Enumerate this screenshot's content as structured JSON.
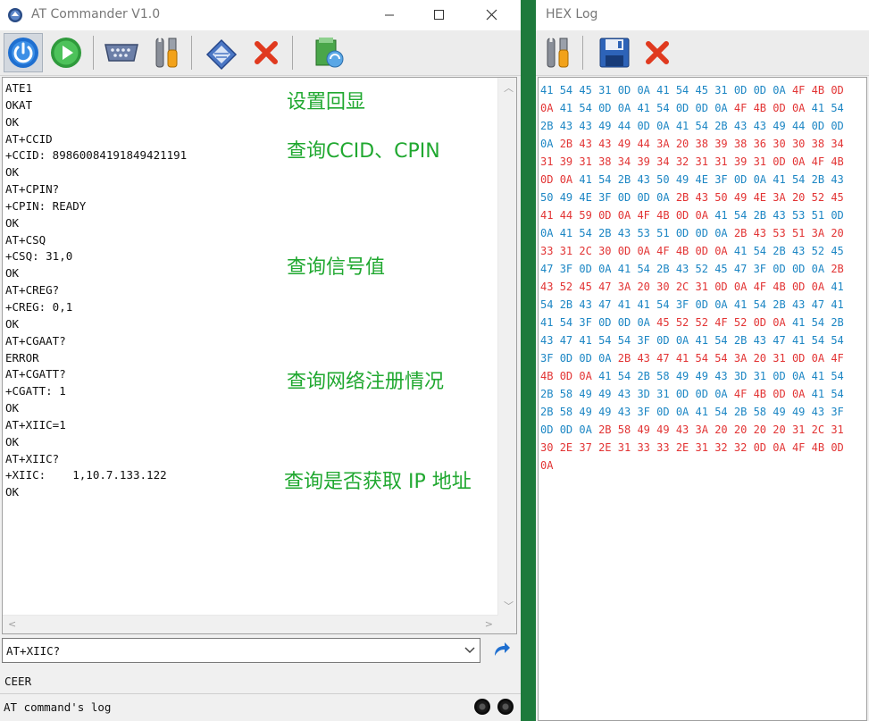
{
  "main_window": {
    "title": "AT Commander V1.0",
    "toolbar": {
      "buttons": [
        {
          "name": "power",
          "icon": "power-icon"
        },
        {
          "name": "run",
          "icon": "play-icon"
        },
        {
          "name": "serial-port",
          "icon": "serial-port-icon"
        },
        {
          "name": "settings",
          "icon": "tools-icon"
        },
        {
          "name": "send-file",
          "icon": "eraser-icon"
        },
        {
          "name": "clear",
          "icon": "close-icon"
        },
        {
          "name": "script",
          "icon": "script-icon"
        }
      ]
    },
    "log_lines": [
      "ATE1",
      "OKAT",
      "OK",
      "AT+CCID",
      "+CCID: 89860084191849421191",
      "OK",
      "AT+CPIN?",
      "+CPIN: READY",
      "OK",
      "AT+CSQ",
      "+CSQ: 31,0",
      "OK",
      "AT+CREG?",
      "+CREG: 0,1",
      "OK",
      "AT+CGAAT?",
      "ERROR",
      "AT+CGATT?",
      "+CGATT: 1",
      "OK",
      "AT+XIIC=1",
      "OK",
      "AT+XIIC?",
      "+XIIC:    1,10.7.133.122",
      "OK"
    ],
    "annotations": [
      "设置回显",
      "查询CCID、CPIN",
      "查询信号值",
      "查询网络注册情况",
      "查询是否获取 IP 地址"
    ],
    "command_input": {
      "value": "AT+XIIC?"
    },
    "status_line": "CEER",
    "status_bar": {
      "label": "AT command's log"
    },
    "colors": {
      "annotation": "#20a830",
      "titlebar": "#ffffff",
      "window": "#f0f0f0"
    }
  },
  "hex_window": {
    "title": "HEX Log",
    "toolbar": {
      "buttons": [
        {
          "name": "settings",
          "icon": "tools-icon"
        },
        {
          "name": "save",
          "icon": "save-icon"
        },
        {
          "name": "clear",
          "icon": "close-icon"
        }
      ]
    },
    "hex_lines": [
      "41 54 45 31 0D 0A 41 54 45 31 0D 0D 0A 4F 4B 0D",
      "0A 41 54 0D 0A 41 54 0D 0D 0A 4F 4B 0D 0A 41 54",
      "2B 43 43 49 44 0D 0A 41 54 2B 43 43 49 44 0D 0D",
      "0A 2B 43 43 49 44 3A 20 38 39 38 36 30 30 38 34",
      "31 39 31 38 34 39 34 32 31 31 39 31 0D 0A 4F 4B",
      "0D 0A 41 54 2B 43 50 49 4E 3F 0D 0A 41 54 2B 43",
      "50 49 4E 3F 0D 0D 0A 2B 43 50 49 4E 3A 20 52 45",
      "41 44 59 0D 0A 4F 4B 0D 0A 41 54 2B 43 53 51 0D",
      "0A 41 54 2B 43 53 51 0D 0D 0A 2B 43 53 51 3A 20",
      "33 31 2C 30 0D 0A 4F 4B 0D 0A 41 54 2B 43 52 45",
      "47 3F 0D 0A 41 54 2B 43 52 45 47 3F 0D 0D 0A 2B",
      "43 52 45 47 3A 20 30 2C 31 0D 0A 4F 4B 0D 0A 41",
      "54 2B 43 47 41 41 54 3F 0D 0A 41 54 2B 43 47 41",
      "41 54 3F 0D 0D 0A 45 52 52 4F 52 0D 0A 41 54 2B",
      "43 47 41 54 54 3F 0D 0A 41 54 2B 43 47 41 54 54",
      "3F 0D 0D 0A 2B 43 47 41 54 54 3A 20 31 0D 0A 4F",
      "4B 0D 0A 41 54 2B 58 49 49 43 3D 31 0D 0A 41 54",
      "2B 58 49 49 43 3D 31 0D 0D 0A 4F 4B 0D 0A 41 54",
      "2B 58 49 49 43 3F 0D 0A 41 54 2B 58 49 49 43 3F",
      "0D 0D 0A 2B 58 49 49 43 3A 20 20 20 20 31 2C 31",
      "30 2E 37 2E 31 33 33 2E 31 32 32 0D 0A 4F 4B 0D",
      "0A"
    ],
    "colors": {
      "sent": "#e23434",
      "received": "#1c86c4"
    }
  },
  "desktop_color": "#1e7a3c"
}
